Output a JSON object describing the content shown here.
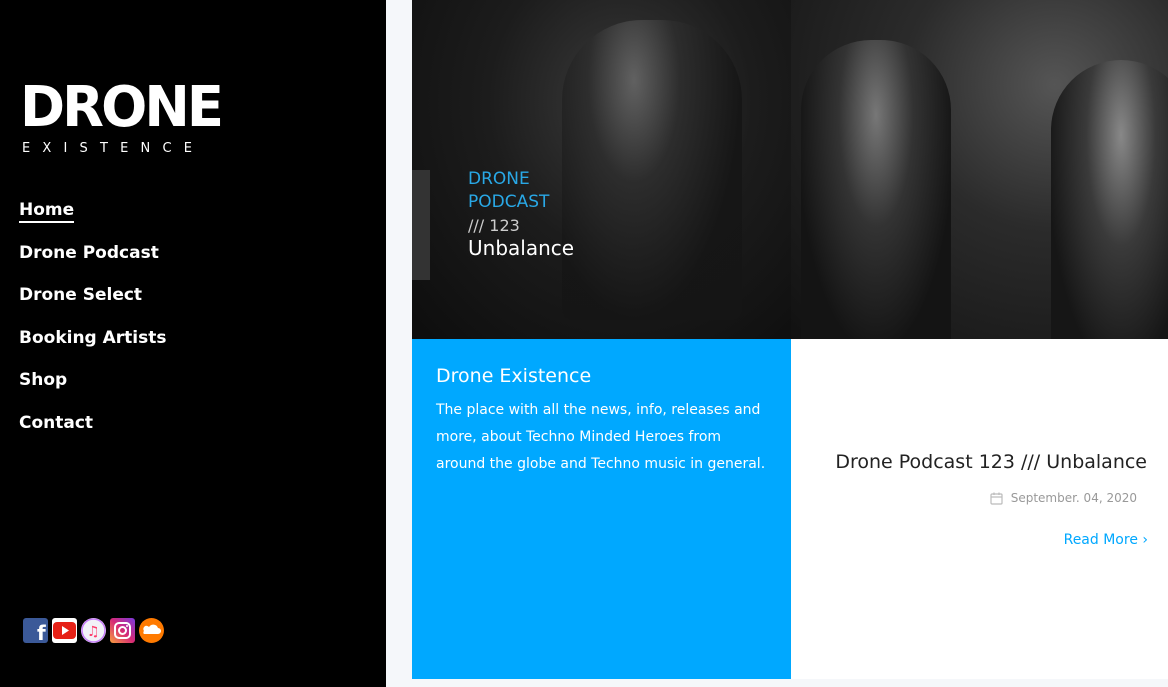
{
  "logo": {
    "word": "DRONE",
    "sub": "EXISTENCE"
  },
  "nav": {
    "items": [
      {
        "label": "Home"
      },
      {
        "label": "Drone Podcast"
      },
      {
        "label": "Drone Select"
      },
      {
        "label": "Booking Artists"
      },
      {
        "label": "Shop"
      },
      {
        "label": "Contact"
      }
    ]
  },
  "social": {
    "icons": [
      "facebook-icon",
      "youtube-icon",
      "itunes-icon",
      "instagram-icon",
      "soundcloud-icon"
    ]
  },
  "podcast_image": {
    "line1": "DRONE",
    "line2": "PODCAST",
    "line3": "/// 123",
    "title": "Unbalance"
  },
  "intro": {
    "title": "Drone Existence",
    "text": "The place with all the news, info, releases and more, about Techno Minded Heroes from around the globe and Techno music in general."
  },
  "post": {
    "title": "Drone Podcast 123 /// Unbalance",
    "date": "September. 04, 2020",
    "read_more": "Read More"
  },
  "colors": {
    "accent": "#00a8ff",
    "sidebar": "#000000"
  }
}
